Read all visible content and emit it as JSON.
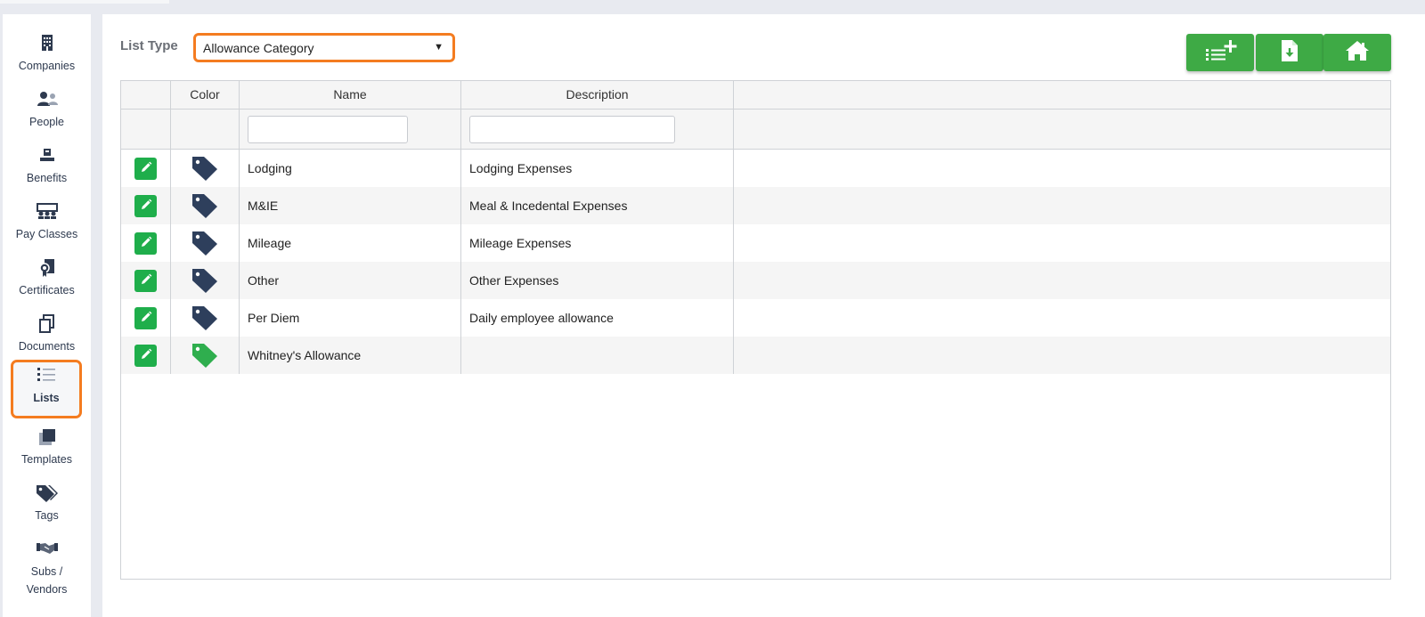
{
  "sidebar": {
    "items": [
      {
        "label": "Companies",
        "icon": "building-icon"
      },
      {
        "label": "People",
        "icon": "people-icon"
      },
      {
        "label": "Benefits",
        "icon": "benefits-icon"
      },
      {
        "label": "Pay Classes",
        "icon": "pay-classes-icon"
      },
      {
        "label": "Certificates",
        "icon": "certificate-icon"
      },
      {
        "label": "Documents",
        "icon": "documents-icon"
      },
      {
        "label": "Lists",
        "icon": "list-icon",
        "active": true
      },
      {
        "label": "Templates",
        "icon": "templates-icon"
      },
      {
        "label": "Tags",
        "icon": "tags-icon"
      },
      {
        "label": "Subs /",
        "label2": "Vendors",
        "icon": "handshake-icon"
      }
    ]
  },
  "header": {
    "list_type_label": "List Type",
    "list_type_value": "Allowance Category"
  },
  "toolbar": {
    "buttons": [
      "add-list-item-icon",
      "export-file-icon",
      "home-icon"
    ]
  },
  "table": {
    "columns": [
      "",
      "Color",
      "Name",
      "Description"
    ],
    "rows": [
      {
        "name": "Lodging",
        "description": "Lodging Expenses",
        "tag_color": "#2e3f5c"
      },
      {
        "name": "M&IE",
        "description": "Meal & Incedental Expenses",
        "tag_color": "#2e3f5c"
      },
      {
        "name": "Mileage",
        "description": "Mileage Expenses",
        "tag_color": "#2e3f5c"
      },
      {
        "name": "Other",
        "description": "Other Expenses",
        "tag_color": "#2e3f5c"
      },
      {
        "name": "Per Diem",
        "description": "Daily employee allowance",
        "tag_color": "#2e3f5c"
      },
      {
        "name": "Whitney's Allowance",
        "description": "",
        "tag_color": "#2fae4e"
      }
    ]
  },
  "colors": {
    "accent_orange": "#f47c20",
    "button_green": "#3eaa45",
    "edit_green": "#1fae4b",
    "sidebar_icon": "#2e3a4f"
  }
}
